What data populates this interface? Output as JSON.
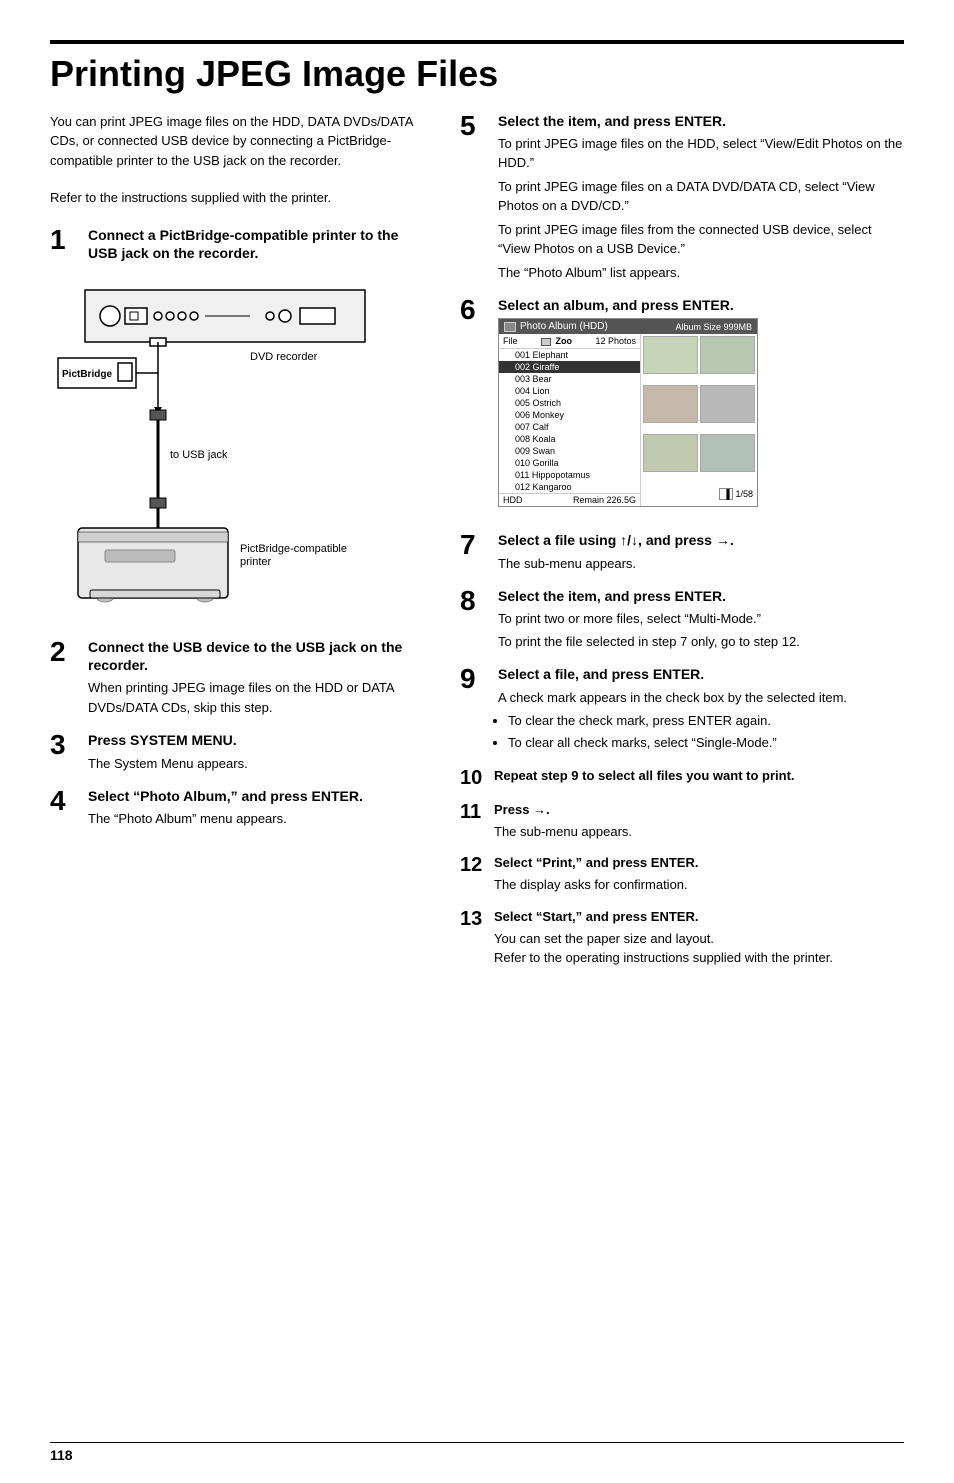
{
  "page": {
    "number": "118",
    "title": "Printing JPEG Image Files",
    "top_rule": true
  },
  "intro": {
    "text": "You can print JPEG image files on the HDD, DATA DVDs/DATA CDs, or connected USB device by connecting a PictBridge-compatible printer to the USB jack on the recorder.",
    "text2": "Refer to the instructions supplied with the printer."
  },
  "steps": [
    {
      "num": "1",
      "size": "large",
      "title": "Connect a PictBridge-compatible printer to the USB jack on the recorder."
    },
    {
      "num": "2",
      "size": "large",
      "title": "Connect the USB device to the USB jack on the recorder.",
      "body": "When printing JPEG image files on the HDD or DATA DVDs/DATA CDs, skip this step."
    },
    {
      "num": "3",
      "size": "large",
      "title": "Press SYSTEM MENU.",
      "body": "The System Menu appears."
    },
    {
      "num": "4",
      "size": "large",
      "title": "Select “Photo Album,” and press ENTER.",
      "body": "The “Photo Album” menu appears."
    },
    {
      "num": "5",
      "size": "large",
      "title": "Select the item, and press ENTER.",
      "body1": "To print JPEG image files on the HDD, select “View/Edit Photos on the HDD.”",
      "body2": "To print JPEG image files on a DATA DVD/DATA CD, select “View Photos on a DVD/CD.”",
      "body3": "To print JPEG image files from the connected USB device, select “View Photos on a USB Device.”",
      "body4": "The “Photo Album” list appears."
    },
    {
      "num": "6",
      "size": "large",
      "title": "Select an album, and press ENTER."
    },
    {
      "num": "7",
      "size": "large",
      "title": "Select a file using ↑/↓, and press →.",
      "body": "The sub-menu appears."
    },
    {
      "num": "8",
      "size": "large",
      "title": "Select the item, and press ENTER.",
      "body1": "To print two or more files, select “Multi-Mode.”",
      "body2": "To print the file selected in step 7 only, go to step 12."
    },
    {
      "num": "9",
      "size": "large",
      "title": "Select a file, and press ENTER.",
      "body": "A check mark appears in the check box by the selected item.",
      "bullets": [
        "To clear the check mark, press ENTER again.",
        "To clear all check marks, select “Single-Mode.”"
      ]
    },
    {
      "num": "10",
      "size": "small",
      "title": "Repeat step 9 to select all files you want to print."
    },
    {
      "num": "11",
      "size": "small",
      "title": "Press →.",
      "body": "The sub-menu appears."
    },
    {
      "num": "12",
      "size": "small",
      "title": "Select “Print,” and press ENTER.",
      "body": "The display asks for confirmation."
    },
    {
      "num": "13",
      "size": "small",
      "title": "Select “Start,” and press ENTER.",
      "body1": "You can set the paper size and layout.",
      "body2": "Refer to the operating instructions supplied with the printer."
    }
  ],
  "diagram": {
    "dvd_label": "DVD recorder",
    "pictbridge_label": "PictBridge",
    "usb_jack_label": "to USB jack",
    "printer_label": "PictBridge-compatible\nprinter"
  },
  "photo_album": {
    "title": "Photo Album (HDD)",
    "album_size": "Album Size 999MB",
    "folder": "Zoo",
    "photos_count": "12 Photos",
    "file_label": "File",
    "items": [
      {
        "num": "001",
        "name": "Elephant"
      },
      {
        "num": "002",
        "name": "Giraffe"
      },
      {
        "num": "003",
        "name": "Bear"
      },
      {
        "num": "004",
        "name": "Lion"
      },
      {
        "num": "005",
        "name": "Ostrich"
      },
      {
        "num": "006",
        "name": "Monkey"
      },
      {
        "num": "007",
        "name": "Calf"
      },
      {
        "num": "008",
        "name": "Koala"
      },
      {
        "num": "009",
        "name": "Swan"
      },
      {
        "num": "010",
        "name": "Gorilla"
      },
      {
        "num": "011",
        "name": "Hippopotamus"
      },
      {
        "num": "012",
        "name": "Kangaroo"
      }
    ],
    "hdd_label": "HDD",
    "remain_label": "Remain\n226.5G",
    "page_indicator": "1/58"
  }
}
